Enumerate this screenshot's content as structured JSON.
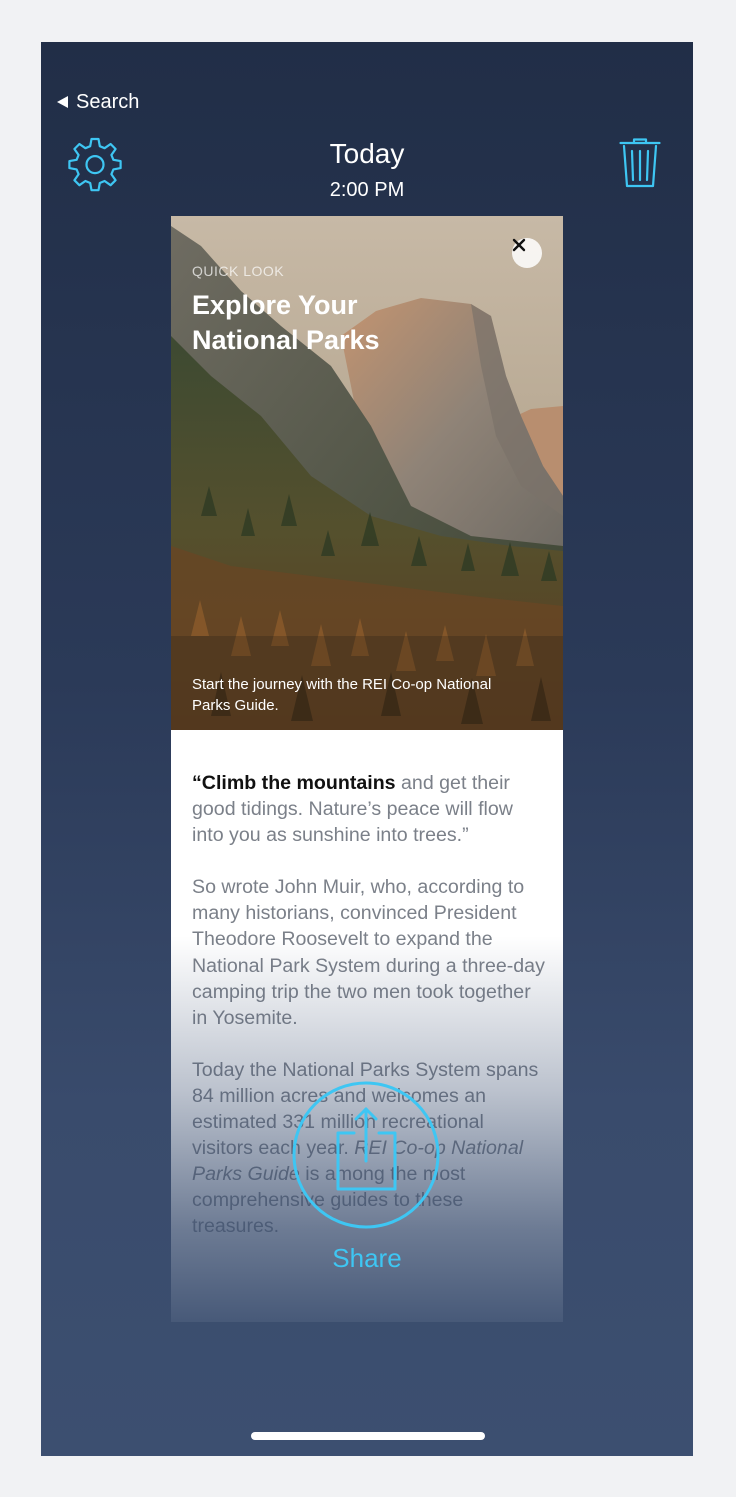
{
  "nav": {
    "back_label": "Search"
  },
  "header": {
    "title": "Today",
    "time": "2:00 PM"
  },
  "card": {
    "eyebrow": "QUICK LOOK",
    "headline_line1": "Explore Your",
    "headline_line2": "National Parks",
    "caption": "Start the journey with the REI Co-op National Parks Guide.",
    "quote_bold": "“Climb the mountains",
    "quote_rest": " and get their good tidings. Nature’s peace will flow into you as sunshine into trees.”",
    "para2": "So wrote John Muir, who, according to many historians, convinced President Theodore Roosevelt to expand the National Park System during a three-day camping trip the two men took together in Yosemite.",
    "para3_start": "Today the National Parks System spans 84 million acres and welcomes an estimated 331 million recreational visitors each year. ",
    "para3_italic": "REI Co-op National Parks Guide",
    "para3_end": " is among the most comprehensive guides to these treasures."
  },
  "share": {
    "label": "Share"
  },
  "icons": {
    "gear": "gear-icon",
    "trash": "trash-icon",
    "close": "close-icon",
    "share": "share-icon",
    "back": "back-arrow-icon"
  },
  "colors": {
    "accent": "#3ec6f3",
    "background": "#243250"
  }
}
